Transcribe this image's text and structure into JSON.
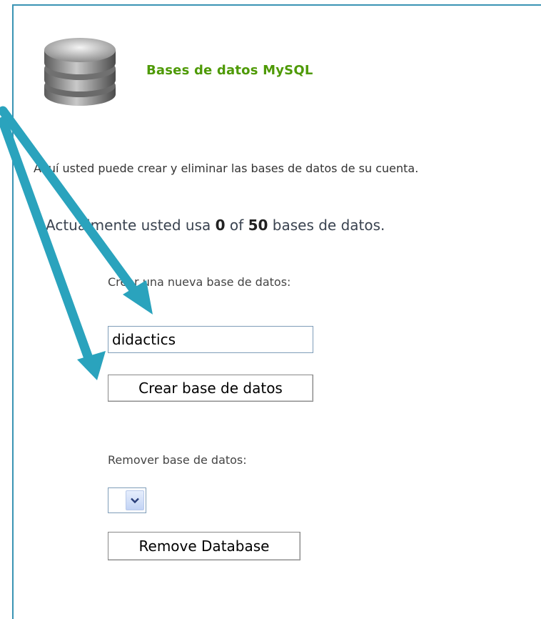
{
  "header": {
    "title": "Bases de datos MySQL",
    "icon": "database-icon"
  },
  "intro_text": "Aquí usted puede crear y eliminar las bases de datos de su cuenta.",
  "usage": {
    "prefix": "Actualmente usted usa",
    "used": "0",
    "of": "of",
    "total": "50",
    "suffix": "bases de datos."
  },
  "create": {
    "label": "Crear una nueva base de datos:",
    "input_value": "didactics",
    "button_label": "Crear base de datos"
  },
  "remove": {
    "label": "Remover base de datos:",
    "selected_value": "",
    "button_label": "Remove Database"
  },
  "colors": {
    "frame_border": "#3a94b4",
    "title_green": "#4e9a06",
    "arrow": "#2aa3bd"
  }
}
